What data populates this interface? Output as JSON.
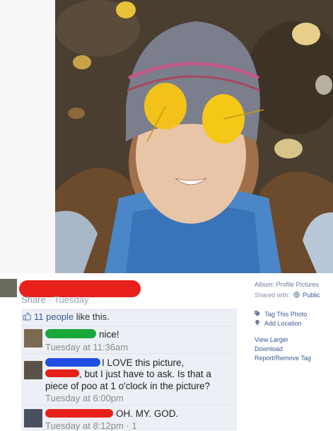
{
  "post": {
    "share_label": "Share",
    "separator": "·",
    "date": "Tuesday",
    "likes_count_link": "11 people",
    "likes_suffix": " like this."
  },
  "comments": [
    {
      "text": "nice!",
      "time": "Tuesday at 11:36am"
    },
    {
      "text_line1": "I LOVE this picture,",
      "text_line2": ", but I just have to ask. Is that a",
      "text_line3": "piece of poo at 1 o'clock in the picture?",
      "time": "Tuesday at 6:00pm"
    },
    {
      "text": "OH. MY. GOD.",
      "time": "Tuesday at 8:12pm · 1"
    }
  ],
  "sidebar": {
    "album": "Album: Profile Pictures",
    "shared_with_label": "Shared with:",
    "shared_with_value": "Public",
    "tag_photo": "Tag This Photo",
    "add_location": "Add Location",
    "view_larger": "View Larger",
    "download": "Download",
    "report_remove_tag": "Report/Remove Tag"
  },
  "colors": {
    "link": "#3b5998",
    "comment_bg": "#eceff5",
    "redaction": "#e8201c"
  }
}
